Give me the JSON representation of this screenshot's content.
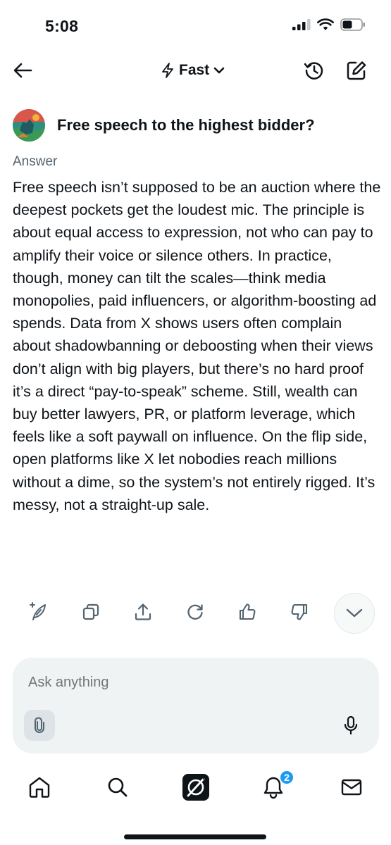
{
  "status_bar": {
    "time": "5:08"
  },
  "header": {
    "back_icon": "arrow-left-icon",
    "mode_label": "Fast",
    "mode_icon": "lightning-icon",
    "mode_chevron_icon": "chevron-down-icon",
    "history_icon": "history-icon",
    "new_chat_icon": "compose-icon"
  },
  "conversation": {
    "question": "Free speech to the highest bidder?",
    "answer_label": "Answer",
    "answer_text": "Free speech isn’t supposed to be an auction where the deepest pockets get the loudest mic. The principle is about equal access to expression, not who can pay to amplify their voice or silence others. In practice, though, money can tilt the scales—think media monopolies, paid influencers, or algorithm-boosting ad spends. Data from X shows users often complain about shadowbanning or deboosting when their views don’t align with big players, but there’s no hard proof it’s a direct “pay-to-speak” scheme. Still, wealth can buy better lawyers, PR, or platform leverage, which feels like a soft paywall on influence. On the flip side, open platforms like X let nobodies reach millions without a dime, so the system’s not entirely rigged. It’s messy, not a straight-up sale."
  },
  "actions": [
    {
      "icon": "sparkle-feather-icon"
    },
    {
      "icon": "copy-icon"
    },
    {
      "icon": "share-icon"
    },
    {
      "icon": "regenerate-icon"
    },
    {
      "icon": "thumbs-up-icon"
    },
    {
      "icon": "thumbs-down-icon"
    },
    {
      "icon": "chevron-down-icon"
    }
  ],
  "composer": {
    "placeholder": "Ask anything",
    "attach_icon": "paperclip-icon",
    "mic_icon": "microphone-icon"
  },
  "tab_bar": {
    "tabs": [
      {
        "icon": "home-icon"
      },
      {
        "icon": "search-icon"
      },
      {
        "icon": "grok-icon"
      },
      {
        "icon": "bell-icon"
      },
      {
        "icon": "mail-icon"
      }
    ],
    "notification_count": "2",
    "badge_color": "#1d9bf0"
  }
}
